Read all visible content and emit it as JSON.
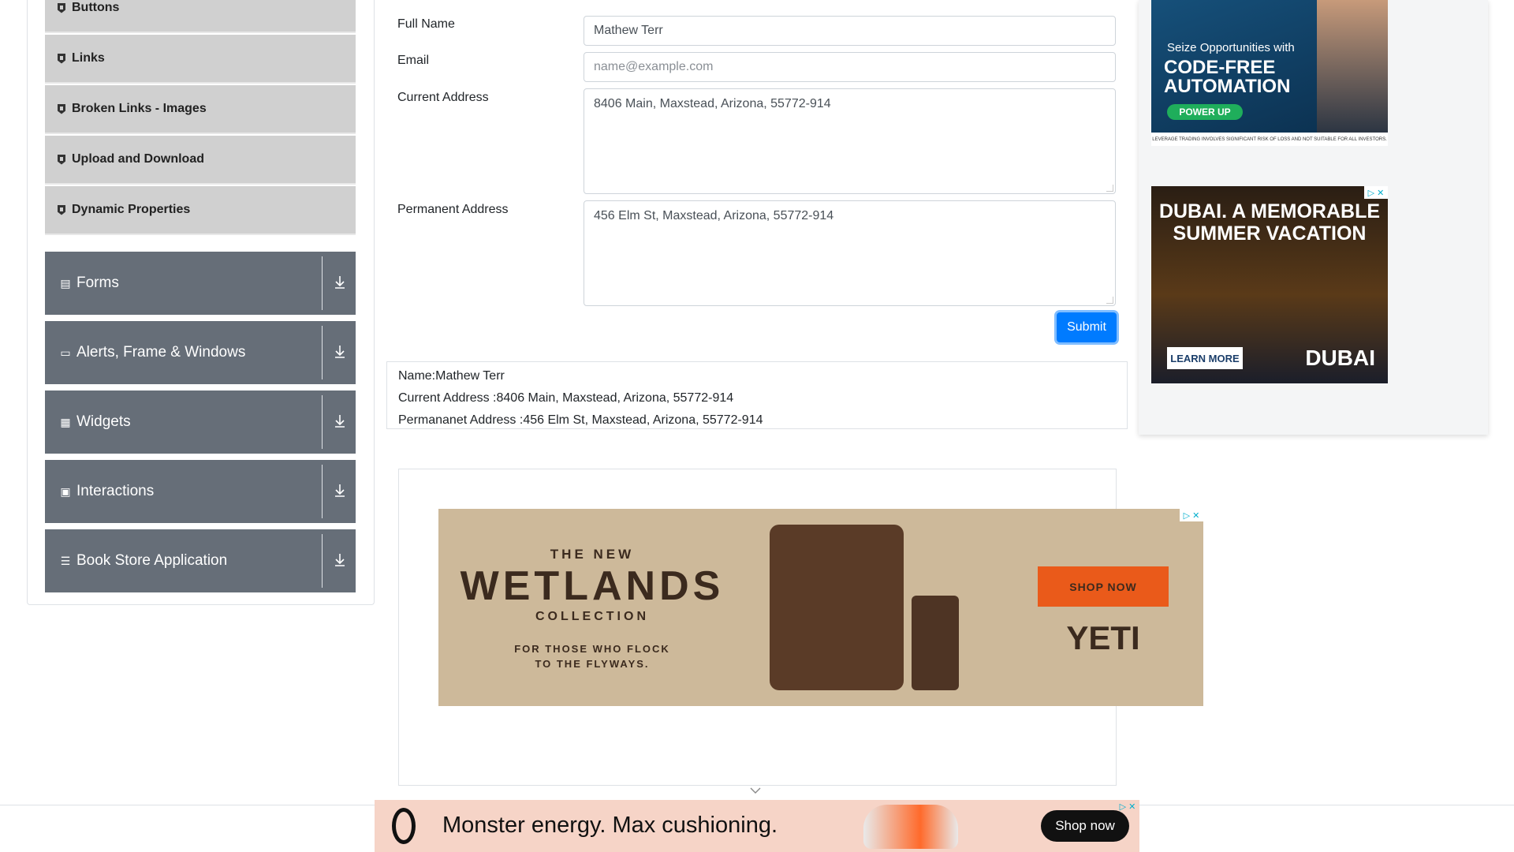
{
  "sidebar": {
    "sub_items": [
      {
        "label": "Buttons"
      },
      {
        "label": "Links"
      },
      {
        "label": "Broken Links - Images"
      },
      {
        "label": "Upload and Download"
      },
      {
        "label": "Dynamic Properties"
      }
    ],
    "groups": [
      {
        "label": "Forms",
        "icon": "form-icon"
      },
      {
        "label": "Alerts, Frame & Windows",
        "icon": "window-icon"
      },
      {
        "label": "Widgets",
        "icon": "widgets-icon"
      },
      {
        "label": "Interactions",
        "icon": "interactions-icon"
      },
      {
        "label": "Book Store Application",
        "icon": "books-icon"
      }
    ]
  },
  "form": {
    "full_name_label": "Full Name",
    "full_name_value": "Mathew Terr",
    "email_label": "Email",
    "email_placeholder": "name@example.com",
    "current_address_label": "Current Address",
    "current_address_value": "8406 Main, Maxstead, Arizona, 55772-914",
    "permanent_address_label": "Permanent Address",
    "permanent_address_value": "456 Elm St, Maxstead, Arizona, 55772-914",
    "submit_label": "Submit"
  },
  "output": {
    "name": "Name:Mathew Terr",
    "current_address": "Current Address :8406 Main, Maxstead, Arizona, 55772-914",
    "permanent_address": "Permananet Address :456 Elm St, Maxstead, Arizona, 55772-914"
  },
  "ads": {
    "code": {
      "headline1": "Seize Opportunities with",
      "headline2": "CODE-FREE",
      "headline3": "AUTOMATION",
      "button": "POWER UP",
      "disclaimer": "LEVERAGE TRADING INVOLVES SIGNIFICANT RISK OF LOSS AND NOT SUITABLE FOR ALL INVESTORS."
    },
    "dubai": {
      "headline1": "DUBAI. A MEMORABLE",
      "headline2": "SUMMER VACATION",
      "button": "LEARN MORE",
      "logo": "DUBAI"
    },
    "yeti": {
      "line1": "THE NEW",
      "line2": "WETLANDS",
      "line3": "COLLECTION",
      "line4": "FOR THOSE WHO FLOCK",
      "line5": "TO THE FLYWAYS.",
      "button": "SHOP NOW",
      "brand": "YETI"
    },
    "on": {
      "headline": "Monster energy. Max cushioning.",
      "button": "Shop now"
    }
  }
}
